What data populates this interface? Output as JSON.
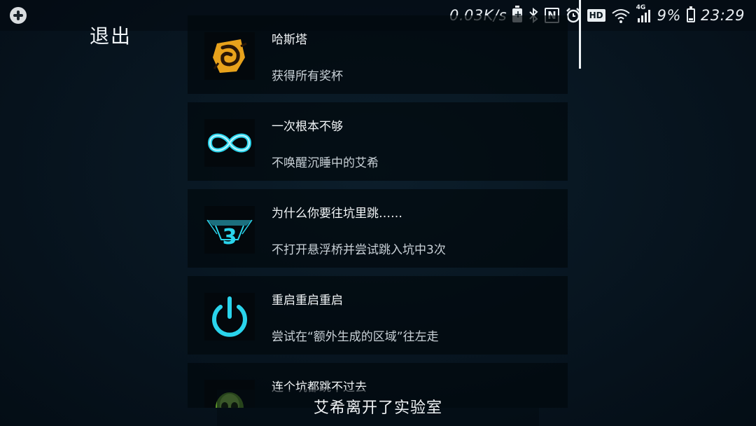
{
  "status_bar": {
    "speed": "0.03K/s",
    "battery_percent": "9%",
    "time": "23:29",
    "network": "4G",
    "hd": "HD",
    "nfc": "N",
    "icons": [
      "game-controller-icon",
      "battery-saver-icon",
      "bluetooth-icon",
      "nfc-icon",
      "alarm-icon",
      "hd-icon",
      "wifi-icon",
      "signal-icon",
      "battery-icon"
    ]
  },
  "exit_label": "退出",
  "achievements": [
    {
      "title": "哈斯塔",
      "description": "获得所有奖杯",
      "icon": "hastur-sigil-icon"
    },
    {
      "title": "一次根本不够",
      "description": "不唤醒沉睡中的艾希",
      "icon": "infinity-icon"
    },
    {
      "title": "为什么你要往坑里跳……",
      "description": "不打开悬浮桥并尝试跳入坑中3次",
      "icon": "pit-three-icon"
    },
    {
      "title": "重启重启重启",
      "description": "尝试在“额外生成的区域”往左走",
      "icon": "power-icon"
    },
    {
      "title": "连个坑都跳不过去",
      "description": "",
      "icon": "skull-icon"
    }
  ],
  "subtitle": "艾希离开了实验室",
  "colors": {
    "accent_cyan": "#2ad4ec",
    "gold": "#e8a21c",
    "skull_green": "#7fc83a"
  }
}
